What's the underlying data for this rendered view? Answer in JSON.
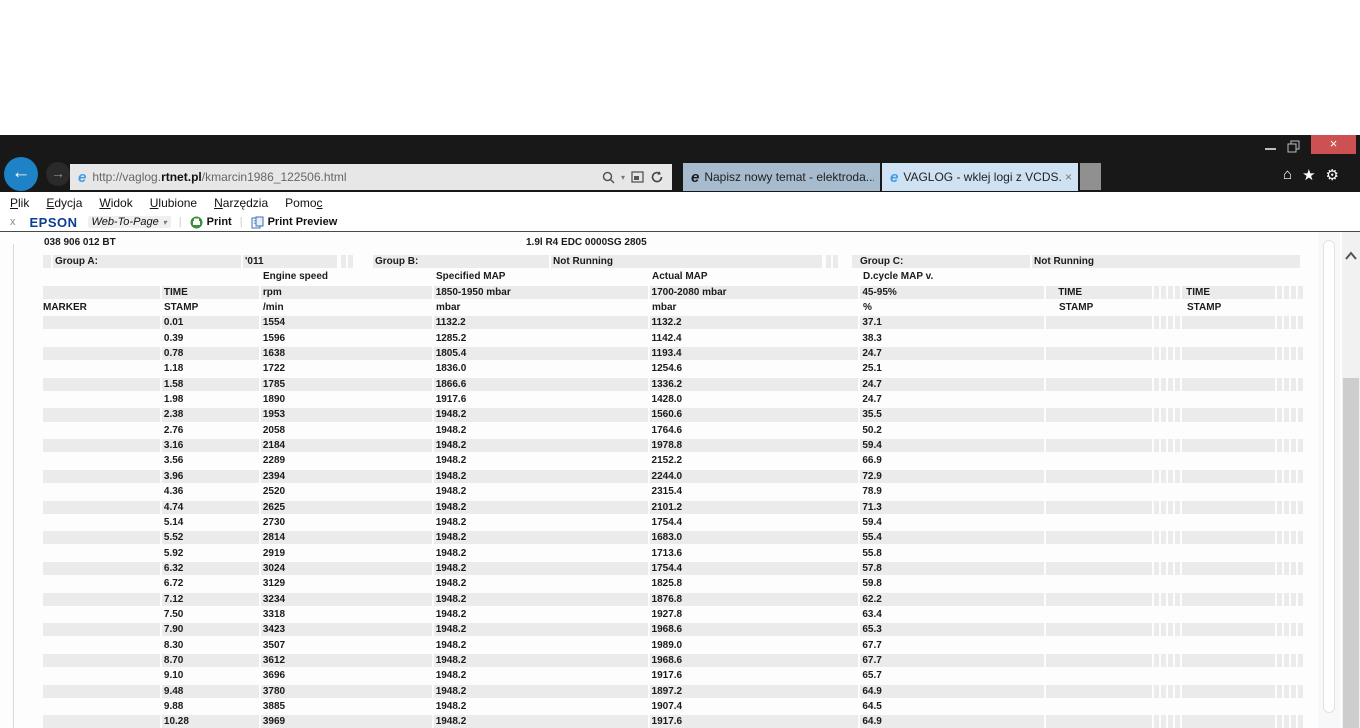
{
  "window": {
    "close_label": "×"
  },
  "nav": {
    "back_label": "←",
    "forward_label": "→",
    "url_prefix": "http://vaglog.",
    "url_domain": "rtnet.pl",
    "url_path": "/kmarcin1986_122506.html",
    "caret": "▾",
    "tabs": [
      {
        "title": "Napisz nowy temat - elektroda...",
        "icon": "e"
      },
      {
        "title": "VAGLOG - wklej logi z VCDS...",
        "icon": "e",
        "close_label": "×"
      }
    ],
    "home_icon": "⌂",
    "star_icon": "★",
    "gear_icon": "⚙",
    "ie_icon": "e"
  },
  "menu": {
    "items": [
      {
        "label": "Plik",
        "accel": 0
      },
      {
        "label": "Edycja",
        "accel": 0
      },
      {
        "label": "Widok",
        "accel": 0
      },
      {
        "label": "Ulubione",
        "accel": 0
      },
      {
        "label": "Narzędzia",
        "accel": 0
      },
      {
        "label": "Pomoc",
        "accel": 4
      }
    ]
  },
  "epson": {
    "close_label": "x",
    "brand": "EPSON",
    "tool_label": "Web-To-Page",
    "print_label": "Print",
    "print_preview_label": "Print Preview",
    "separator": "|"
  },
  "log": {
    "controller": "038 906 012 BT",
    "ecu": "1.9l R4 EDC 0000SG 2805",
    "group_a_label": "Group A:",
    "group_a_value": "'011",
    "group_b_label": "Group B:",
    "group_b_value": "Not Running",
    "group_c_label": "Group C:",
    "group_c_value": "Not Running",
    "field_names": {
      "rpm": "Engine speed",
      "spec": "Specified MAP",
      "act": "Actual MAP",
      "duty": "D.cycle MAP v."
    },
    "ranges": {
      "time": "TIME",
      "rpm": "rpm",
      "spec": "1850-1950 mbar",
      "act": "1700-2080 mbar",
      "duty": "45-95%",
      "time2": "TIME",
      "time3": "TIME"
    },
    "units": {
      "marker": "MARKER",
      "stamp": "STAMP",
      "rpm": "/min",
      "spec": "mbar",
      "act": "mbar",
      "duty": "%",
      "stamp2": "STAMP",
      "stamp3": "STAMP"
    },
    "rows": [
      [
        "0.01",
        "1554",
        "1132.2",
        "1132.2",
        "37.1"
      ],
      [
        "0.39",
        "1596",
        "1285.2",
        "1142.4",
        "38.3"
      ],
      [
        "0.78",
        "1638",
        "1805.4",
        "1193.4",
        "24.7"
      ],
      [
        "1.18",
        "1722",
        "1836.0",
        "1254.6",
        "25.1"
      ],
      [
        "1.58",
        "1785",
        "1866.6",
        "1336.2",
        "24.7"
      ],
      [
        "1.98",
        "1890",
        "1917.6",
        "1428.0",
        "24.7"
      ],
      [
        "2.38",
        "1953",
        "1948.2",
        "1560.6",
        "35.5"
      ],
      [
        "2.76",
        "2058",
        "1948.2",
        "1764.6",
        "50.2"
      ],
      [
        "3.16",
        "2184",
        "1948.2",
        "1978.8",
        "59.4"
      ],
      [
        "3.56",
        "2289",
        "1948.2",
        "2152.2",
        "66.9"
      ],
      [
        "3.96",
        "2394",
        "1948.2",
        "2244.0",
        "72.9"
      ],
      [
        "4.36",
        "2520",
        "1948.2",
        "2315.4",
        "78.9"
      ],
      [
        "4.74",
        "2625",
        "1948.2",
        "2101.2",
        "71.3"
      ],
      [
        "5.14",
        "2730",
        "1948.2",
        "1754.4",
        "59.4"
      ],
      [
        "5.52",
        "2814",
        "1948.2",
        "1683.0",
        "55.4"
      ],
      [
        "5.92",
        "2919",
        "1948.2",
        "1713.6",
        "55.8"
      ],
      [
        "6.32",
        "3024",
        "1948.2",
        "1754.4",
        "57.8"
      ],
      [
        "6.72",
        "3129",
        "1948.2",
        "1825.8",
        "59.8"
      ],
      [
        "7.12",
        "3234",
        "1948.2",
        "1876.8",
        "62.2"
      ],
      [
        "7.50",
        "3318",
        "1948.2",
        "1927.8",
        "63.4"
      ],
      [
        "7.90",
        "3423",
        "1948.2",
        "1968.6",
        "65.3"
      ],
      [
        "8.30",
        "3507",
        "1948.2",
        "1989.0",
        "67.7"
      ],
      [
        "8.70",
        "3612",
        "1948.2",
        "1968.6",
        "67.7"
      ],
      [
        "9.10",
        "3696",
        "1948.2",
        "1917.6",
        "65.7"
      ],
      [
        "9.48",
        "3780",
        "1948.2",
        "1897.2",
        "64.9"
      ],
      [
        "9.88",
        "3885",
        "1948.2",
        "1907.4",
        "64.5"
      ],
      [
        "10.28",
        "3969",
        "1948.2",
        "1917.6",
        "64.9"
      ]
    ]
  },
  "colors": {
    "accent_blue": "#1d82c6",
    "close_red": "#cd5152",
    "tab_active": "#cfe2f4",
    "tab_inactive": "#a6bbce",
    "row_gray": "#ebebeb",
    "bar_black": "#181818"
  }
}
